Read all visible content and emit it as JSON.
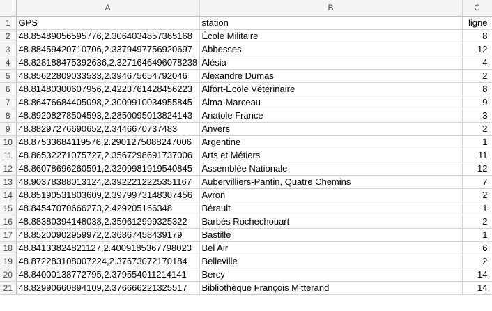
{
  "columns": [
    "A",
    "B",
    "C"
  ],
  "rows": [
    {
      "n": "1",
      "a": "GPS",
      "b": "station",
      "c": "ligne"
    },
    {
      "n": "2",
      "a": "48.85489056595776,2.3064034857365168",
      "b": "École Militaire",
      "c": "8"
    },
    {
      "n": "3",
      "a": "48.88459420710706,2.3379497756920697",
      "b": "Abbesses",
      "c": "12"
    },
    {
      "n": "4",
      "a": "48.828188475392636,2.3271646496078238",
      "b": "Alésia",
      "c": "4"
    },
    {
      "n": "5",
      "a": "48.85622809033533,2.394675654792046",
      "b": "Alexandre Dumas",
      "c": "2"
    },
    {
      "n": "6",
      "a": "48.81480300607956,2.4223761428456223",
      "b": "Alfort-École Vétérinaire",
      "c": "8"
    },
    {
      "n": "7",
      "a": "48.86476684405098,2.3009910034955845",
      "b": "Alma-Marceau",
      "c": "9"
    },
    {
      "n": "8",
      "a": "48.89208278504593,2.2850095013824143",
      "b": "Anatole France",
      "c": "3"
    },
    {
      "n": "9",
      "a": "48.88297276690652,2.3446670737483",
      "b": "Anvers",
      "c": "2"
    },
    {
      "n": "10",
      "a": "48.87533684119576,2.2901275088247006",
      "b": "Argentine",
      "c": "1"
    },
    {
      "n": "11",
      "a": "48.86532271075727,2.3567298691737006",
      "b": "Arts et Métiers",
      "c": "11"
    },
    {
      "n": "12",
      "a": "48.86078696260591,2.3209981919540845",
      "b": "Assemblée Nationale",
      "c": "12"
    },
    {
      "n": "13",
      "a": "48.90378388013124,2.3922212225351167",
      "b": "Aubervilliers-Pantin, Quatre Chemins",
      "c": "7"
    },
    {
      "n": "14",
      "a": "48.85190531803609,2.3979973148307456",
      "b": "Avron",
      "c": "2"
    },
    {
      "n": "15",
      "a": "48.84547070666273,2.429205166348",
      "b": "Bérault",
      "c": "1"
    },
    {
      "n": "16",
      "a": "48.88380394148038,2.350612999325322",
      "b": "Barbès Rochechouart",
      "c": "2"
    },
    {
      "n": "17",
      "a": "48.85200902959972,2.36867458439179",
      "b": "Bastille",
      "c": "1"
    },
    {
      "n": "18",
      "a": "48.84133824821127,2.4009185367798023",
      "b": "Bel Air",
      "c": "6"
    },
    {
      "n": "19",
      "a": "48.872283108007224,2.37673072170184",
      "b": "Belleville",
      "c": "2"
    },
    {
      "n": "20",
      "a": "48.84000138772795,2.379554011214141",
      "b": "Bercy",
      "c": "14"
    },
    {
      "n": "21",
      "a": "48.82990660894109,2.376666221325517",
      "b": "Bibliothèque François Mitterand",
      "c": "14"
    }
  ]
}
